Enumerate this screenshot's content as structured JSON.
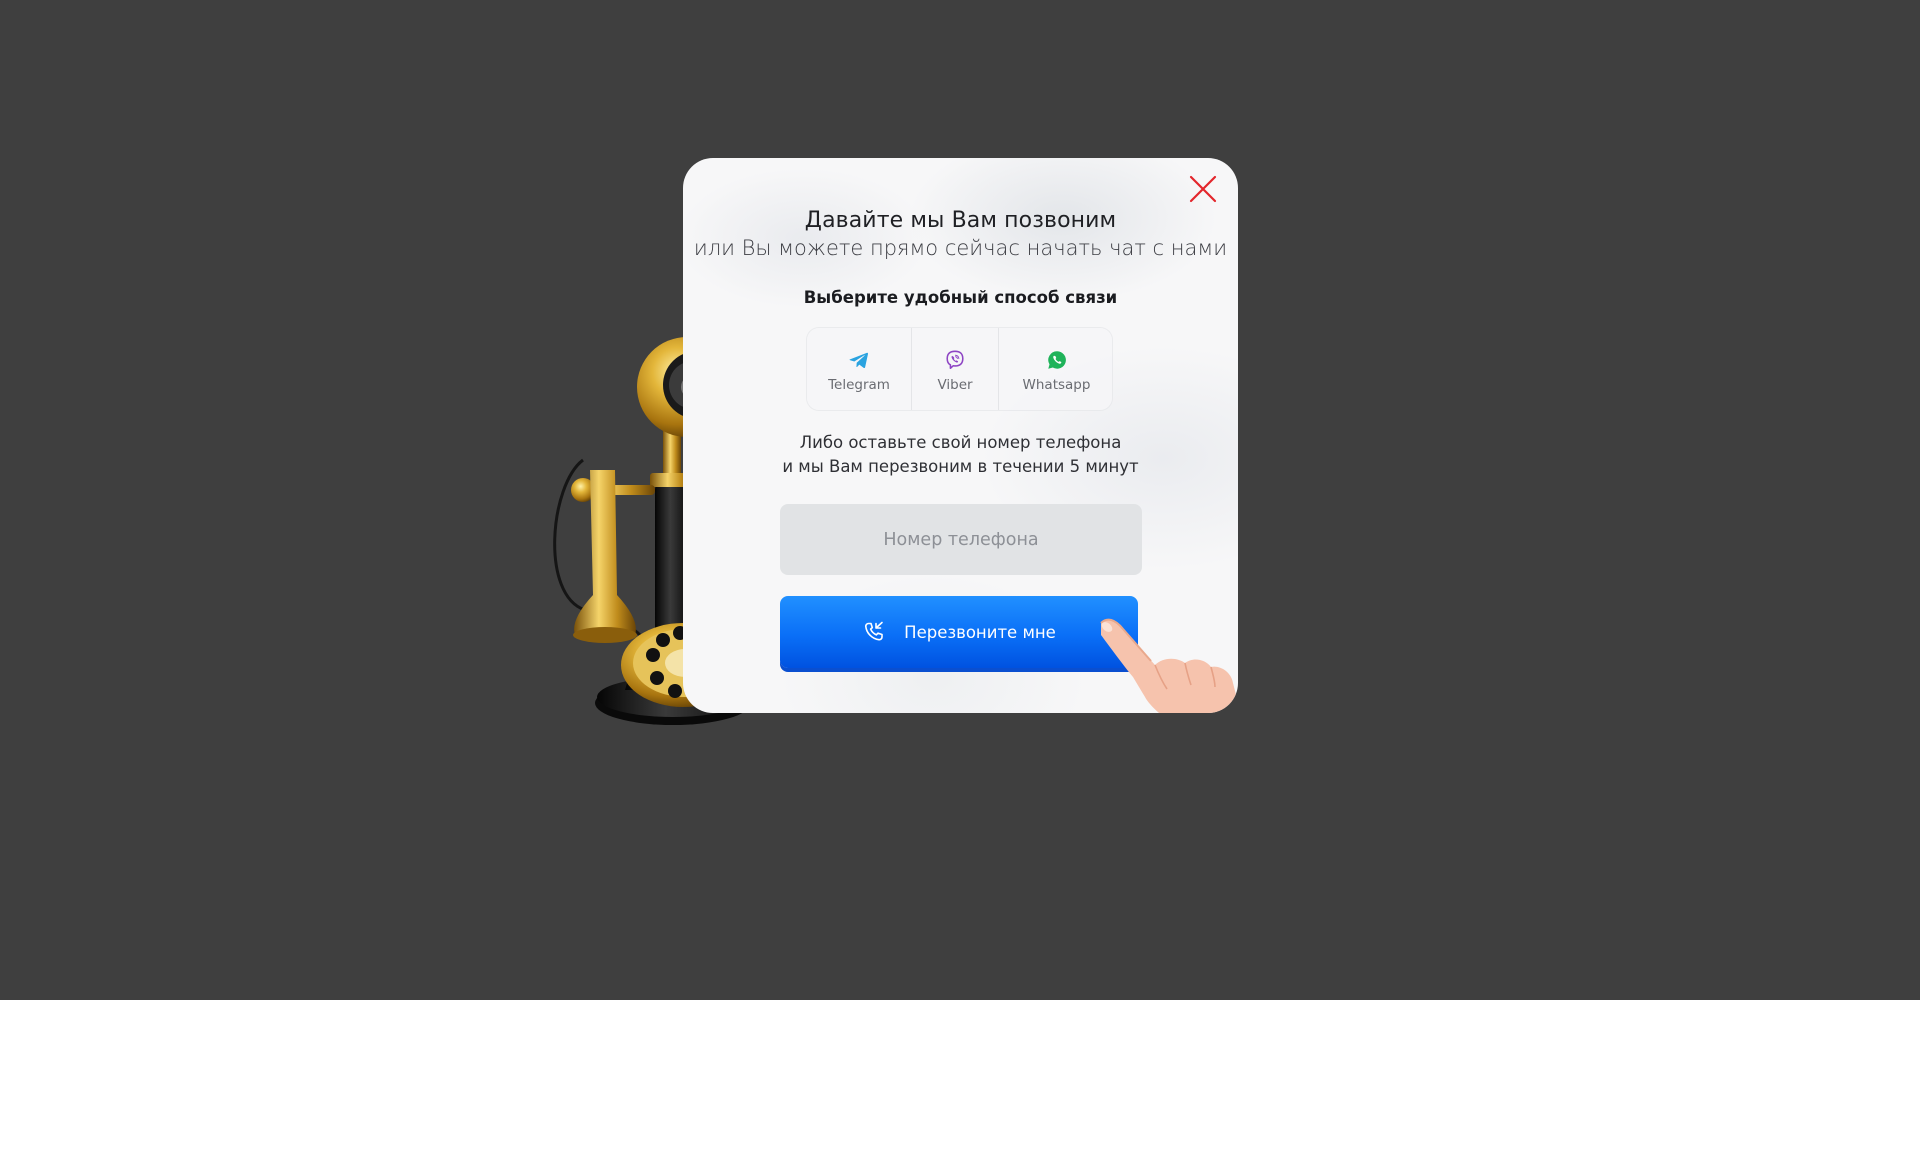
{
  "modal": {
    "title": "Давайте мы Вам позвоним",
    "subtitle": "или Вы можете прямо сейчас  начать чат с нами",
    "choose_label": "Выберите удобный способ связи",
    "messengers": [
      {
        "label": "Telegram",
        "icon": "telegram-icon",
        "color": "#2aa3e0"
      },
      {
        "label": "Viber",
        "icon": "viber-icon",
        "color": "#8e45c4"
      },
      {
        "label": "Whatsapp",
        "icon": "whatsapp-icon",
        "color": "#1fb35a"
      }
    ],
    "note_line1": "Либо оставьте свой номер телефона",
    "note_line2": "и мы Вам перезвоним в течении 5 минут",
    "phone_placeholder": "Номер телефона",
    "call_button_label": "Перезвоните мне",
    "close_icon": "close-icon",
    "close_color": "#e3262c",
    "button_color": "#0a6ff7"
  }
}
